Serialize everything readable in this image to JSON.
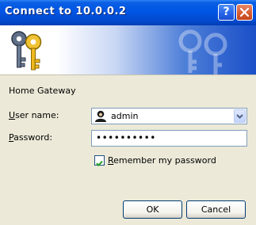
{
  "title": "Connect to 10.0.0.2",
  "titlebar_buttons": {
    "help": "?",
    "close": "X"
  },
  "banner": {
    "icon": "keys-icon"
  },
  "realm": "Home Gateway",
  "username": {
    "label_hotkey": "U",
    "label_rest": "ser name:",
    "value": "admin",
    "icon": "user-icon"
  },
  "password": {
    "label_hotkey": "P",
    "label_rest": "assword:",
    "value": "••••••••••"
  },
  "remember": {
    "hotkey": "R",
    "rest": "emember my password",
    "checked": true
  },
  "buttons": {
    "ok": "OK",
    "cancel": "Cancel"
  },
  "colors": {
    "titlebar": "#0055e5",
    "face": "#ece9d8",
    "field_border": "#7f9db9",
    "checkmark": "#21a121"
  }
}
